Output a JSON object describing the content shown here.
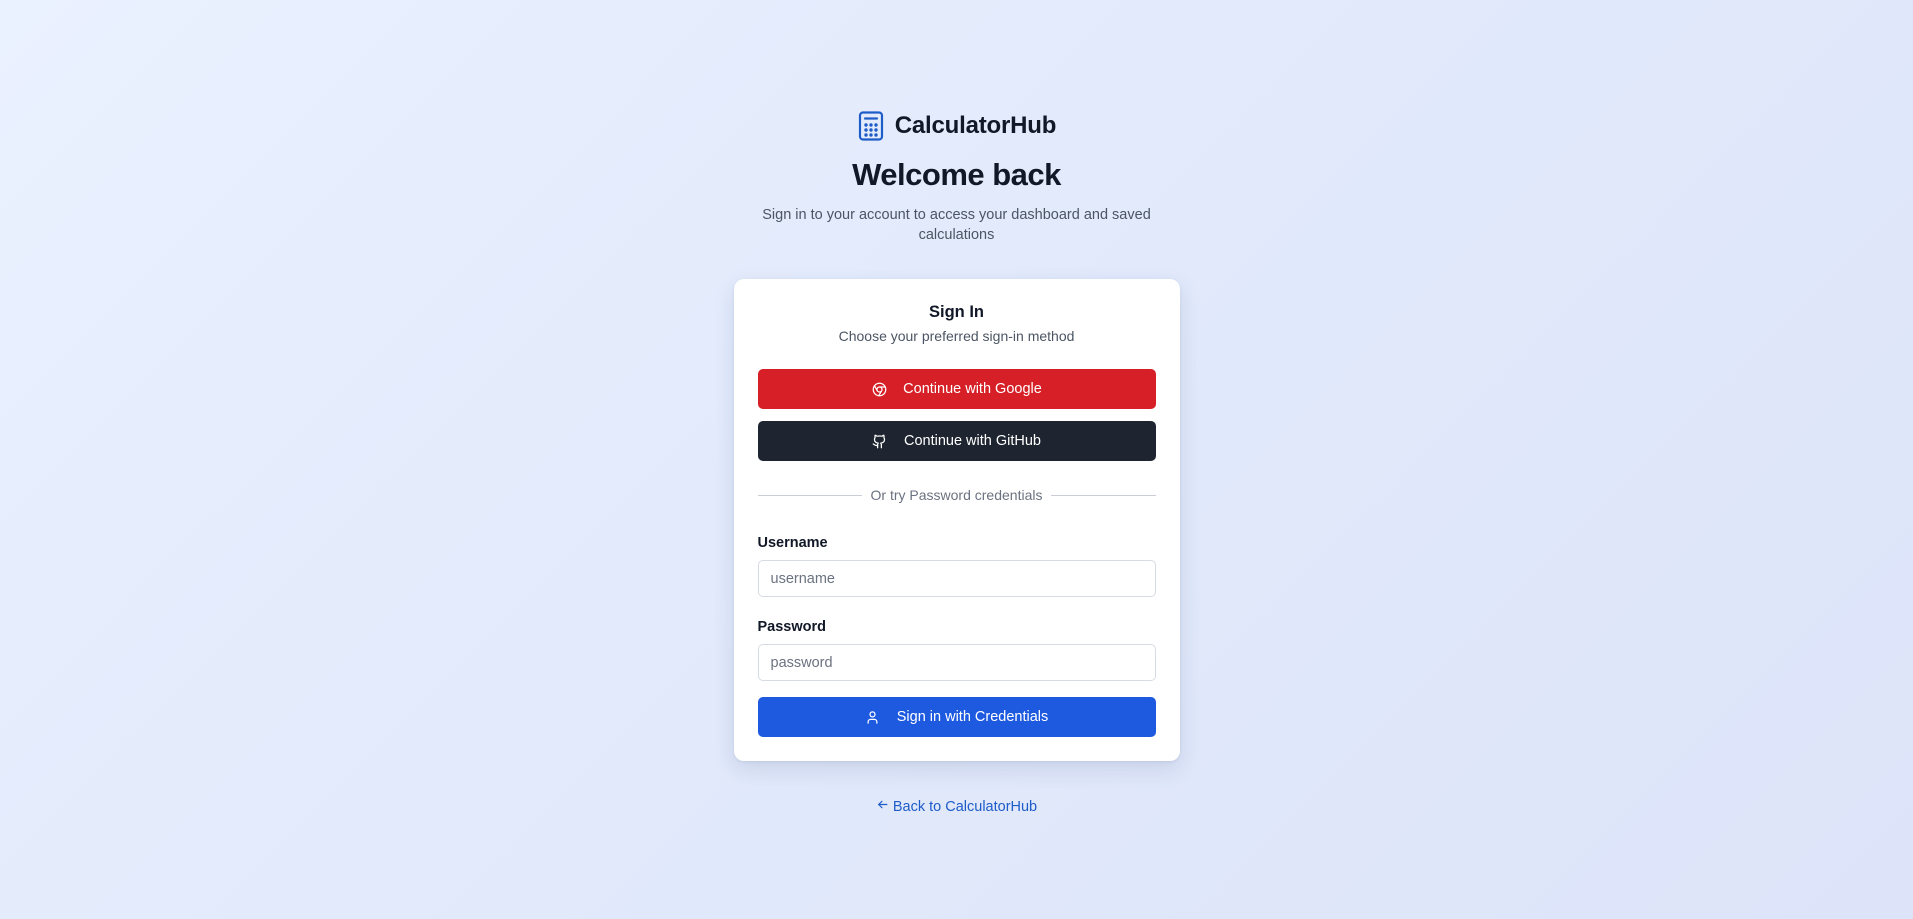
{
  "brand": {
    "name": "CalculatorHub",
    "icon": "calculator-icon",
    "color": "#1e5cc8"
  },
  "header": {
    "title": "Welcome back",
    "subtitle": "Sign in to your account to access your dashboard and saved calculations"
  },
  "card": {
    "title": "Sign In",
    "subtitle": "Choose your preferred sign-in method",
    "google_button": {
      "label": "Continue with Google",
      "icon": "chrome-icon",
      "color": "#d61f26"
    },
    "github_button": {
      "label": "Continue with GitHub",
      "icon": "github-icon",
      "color": "#1f2530"
    },
    "divider_text": "Or try Password credentials",
    "username": {
      "label": "Username",
      "placeholder": "username",
      "value": ""
    },
    "password": {
      "label": "Password",
      "placeholder": "password",
      "value": ""
    },
    "credentials_button": {
      "label": "Sign in with Credentials",
      "icon": "user-icon",
      "color": "#1e5ae0"
    }
  },
  "footer": {
    "back_link": "Back to CalculatorHub",
    "back_icon": "arrow-left-icon"
  }
}
